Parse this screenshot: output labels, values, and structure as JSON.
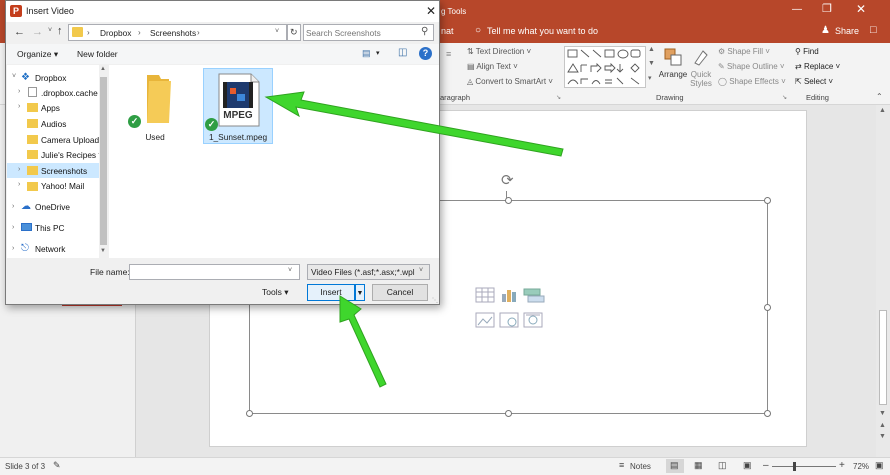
{
  "app": {
    "ribbon_tab_partial_1": "nat",
    "ribbon_tab_partial_2": "g Tools",
    "tell_me": "Tell me what you want to do",
    "share": "Share",
    "ribbon": {
      "text_direction": "Text Direction",
      "align_text": "Align Text",
      "convert_smartart": "Convert to SmartArt",
      "paragraph_group": "aragraph",
      "arrange": "Arrange",
      "quick_styles": "Quick Styles",
      "shape_fill": "Shape Fill",
      "shape_outline": "Shape Outline",
      "shape_effects": "Shape Effects",
      "drawing_group": "Drawing",
      "find": "Find",
      "replace": "Replace",
      "select": "Select",
      "editing_group": "Editing"
    },
    "status": {
      "slide_info": "Slide 3 of 3",
      "notes": "Notes",
      "zoom": "72%"
    }
  },
  "dialog": {
    "title": "Insert Video",
    "breadcrumb": [
      "Dropbox",
      "Screenshots"
    ],
    "search_placeholder": "Search Screenshots",
    "organize": "Organize",
    "new_folder": "New folder",
    "nav_items": [
      "Dropbox",
      ".dropbox.cache",
      "Apps",
      "Audios",
      "Camera Uploads",
      "Julie's Recipes fr",
      "Screenshots",
      "Yahoo! Mail",
      "OneDrive",
      "This PC",
      "Network"
    ],
    "files": [
      {
        "name": "Used",
        "type": "folder"
      },
      {
        "name": "1_Sunset.mpeg",
        "type": "video",
        "badge": "MPEG"
      }
    ],
    "file_name_label": "File name:",
    "file_name_value": "",
    "file_type": "Video Files (*.asf;*.asx;*.wpl;*.w",
    "tools": "Tools",
    "insert": "Insert",
    "cancel": "Cancel"
  },
  "colors": {
    "accent": "#b7472a",
    "arrow": "#3fd62d",
    "selection": "#cce8ff"
  }
}
